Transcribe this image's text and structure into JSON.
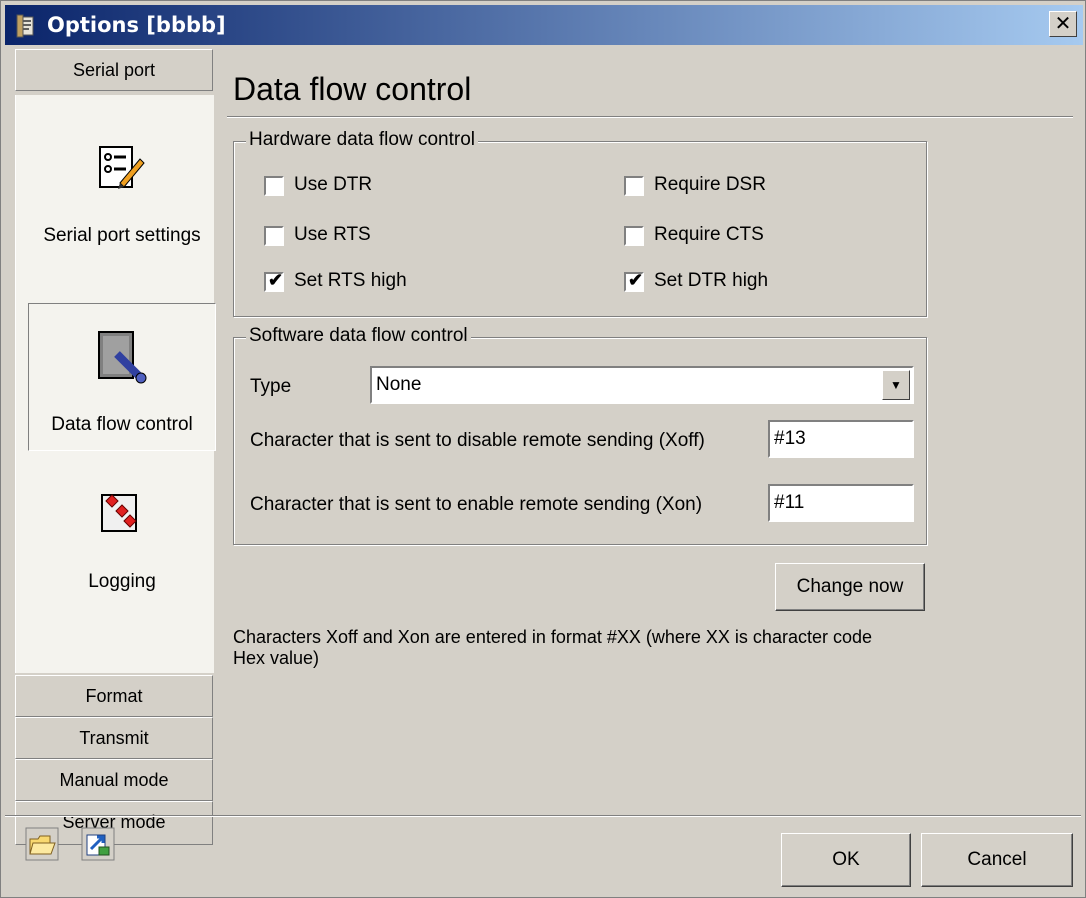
{
  "window": {
    "title": "Options [bbbb]",
    "close_label": "✕"
  },
  "sidebar": {
    "top_tab": "Serial port",
    "items": [
      {
        "label": "Serial port settings",
        "icon": "settings-list-icon",
        "selected": false
      },
      {
        "label": "Data flow control",
        "icon": "data-flow-icon",
        "selected": true
      },
      {
        "label": "Logging",
        "icon": "logging-icon",
        "selected": false
      }
    ],
    "bottom_tabs": [
      "Format",
      "Transmit",
      "Manual mode",
      "Server mode"
    ]
  },
  "panel": {
    "title": "Data flow control",
    "hardware": {
      "label": "Hardware data flow control",
      "checkboxes": [
        {
          "label": "Use DTR",
          "checked": false
        },
        {
          "label": "Require DSR",
          "checked": false
        },
        {
          "label": "Use RTS",
          "checked": false
        },
        {
          "label": "Require CTS",
          "checked": false
        },
        {
          "label": "Set RTS high",
          "checked": true
        },
        {
          "label": "Set DTR high",
          "checked": true
        }
      ]
    },
    "software": {
      "label": "Software data flow control",
      "type_label": "Type",
      "type_value": "None",
      "xoff_label": "Character that is sent to disable remote sending (Xoff)",
      "xoff_value": "#13",
      "xon_label": "Character that is sent to enable remote sending (Xon)",
      "xon_value": "#11"
    },
    "change_now": "Change now",
    "note": "Characters Xoff and Xon are entered in format #XX (where XX is character code Hex value)"
  },
  "footer": {
    "ok": "OK",
    "cancel": "Cancel",
    "icons": [
      "open-folder-icon",
      "export-icon"
    ]
  }
}
